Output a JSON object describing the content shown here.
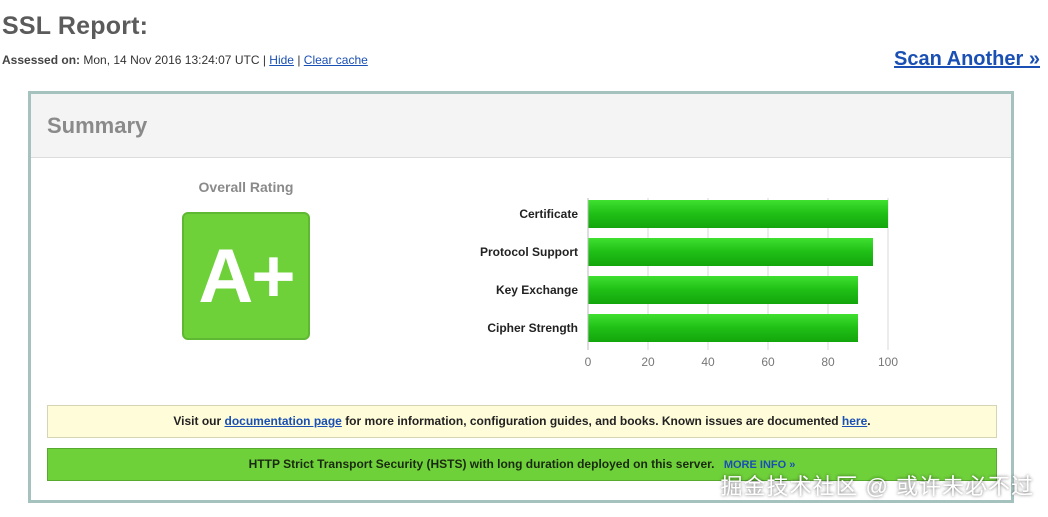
{
  "header": {
    "title": "SSL Report:",
    "assessed_label": "Assessed on:",
    "assessed_value": "Mon, 14 Nov 2016 13:24:07 UTC",
    "sep1": "|",
    "hide_link": "Hide",
    "sep2": "|",
    "clear_cache_link": "Clear cache",
    "scan_another": "Scan Another »"
  },
  "summary": {
    "title": "Summary",
    "overall_label": "Overall Rating",
    "grade": "A+",
    "grade_color": "#6fd13a"
  },
  "chart_data": {
    "type": "bar",
    "orientation": "horizontal",
    "categories": [
      "Certificate",
      "Protocol Support",
      "Key Exchange",
      "Cipher Strength"
    ],
    "values": [
      100,
      95,
      90,
      90
    ],
    "xlim": [
      0,
      100
    ],
    "ticks": [
      0,
      20,
      40,
      60,
      80,
      100
    ],
    "bar_color": "#1fbf16",
    "grid": true
  },
  "notice": {
    "prefix": "Visit our",
    "doc_link": "documentation page",
    "middle": "for more information, configuration guides, and books. Known issues are documented",
    "here_link": "here",
    "suffix": "."
  },
  "hsts": {
    "text": "HTTP Strict Transport Security (HSTS) with long duration deployed on this server.",
    "more_link": "MORE INFO »"
  },
  "watermark": "掘金技术社区 @ 或许未必不过"
}
